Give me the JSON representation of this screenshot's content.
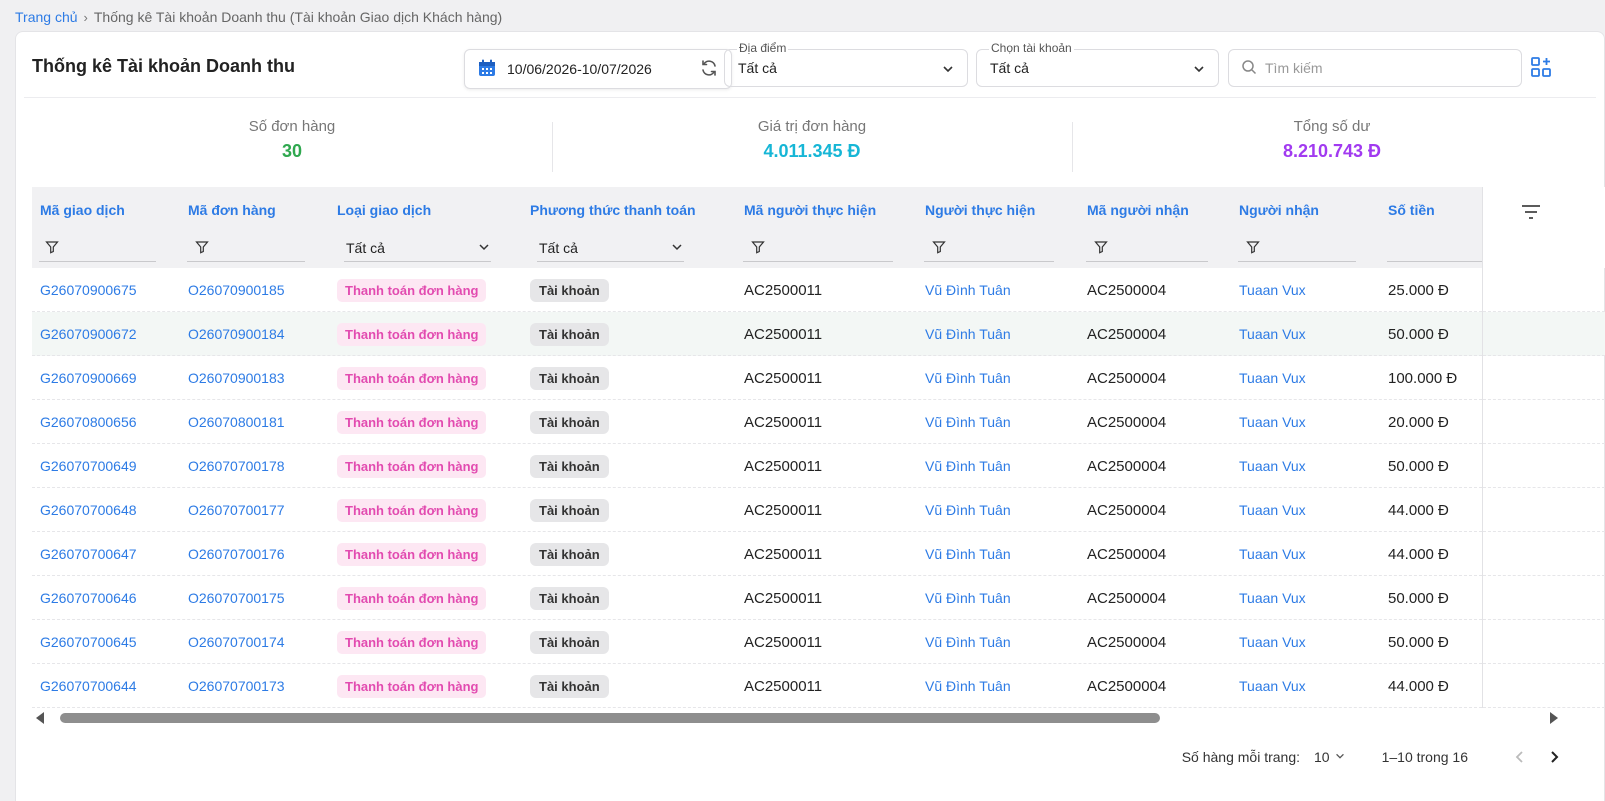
{
  "breadcrumb": {
    "home": "Trang chủ",
    "current": "Thống kê Tài khoản Doanh thu (Tài khoản Giao dịch Khách hàng)"
  },
  "header": {
    "title": "Thống kê Tài khoản Doanh thu",
    "date_range": "10/06/2026-10/07/2026",
    "location": {
      "label": "Địa điểm",
      "value": "Tất cả"
    },
    "account": {
      "label": "Chọn tài khoản",
      "value": "Tất cả"
    },
    "search_placeholder": "Tìm kiếm"
  },
  "stats": [
    {
      "label": "Số đơn hàng",
      "value": "30",
      "color": "#2fa84f"
    },
    {
      "label": "Giá trị đơn hàng",
      "value": "4.011.345 Đ",
      "color": "#16b6d6"
    },
    {
      "label": "Tổng số dư",
      "value": "8.210.743 Đ",
      "color": "#a13af0"
    }
  ],
  "table": {
    "columns": [
      "Mã giao dịch",
      "Mã đơn hàng",
      "Loại giao dịch",
      "Phương thức thanh toán",
      "Mã người thực hiện",
      "Người thực hiện",
      "Mã người nhận",
      "Người nhận",
      "Số tiền"
    ],
    "filters": {
      "type": "Tất cả",
      "method": "Tất cả"
    },
    "rows": [
      {
        "tx": "G26070900675",
        "order": "O26070900185",
        "type": "Thanh toán đơn hàng",
        "method": "Tài khoản",
        "actor_id": "AC2500011",
        "actor": "Vũ Đình Tuân",
        "recv_id": "AC2500004",
        "recv": "Tuaan Vux",
        "amount": "25.000 Đ"
      },
      {
        "tx": "G26070900672",
        "order": "O26070900184",
        "type": "Thanh toán đơn hàng",
        "method": "Tài khoản",
        "actor_id": "AC2500011",
        "actor": "Vũ Đình Tuân",
        "recv_id": "AC2500004",
        "recv": "Tuaan Vux",
        "amount": "50.000 Đ"
      },
      {
        "tx": "G26070900669",
        "order": "O26070900183",
        "type": "Thanh toán đơn hàng",
        "method": "Tài khoản",
        "actor_id": "AC2500011",
        "actor": "Vũ Đình Tuân",
        "recv_id": "AC2500004",
        "recv": "Tuaan Vux",
        "amount": "100.000 Đ"
      },
      {
        "tx": "G26070800656",
        "order": "O26070800181",
        "type": "Thanh toán đơn hàng",
        "method": "Tài khoản",
        "actor_id": "AC2500011",
        "actor": "Vũ Đình Tuân",
        "recv_id": "AC2500004",
        "recv": "Tuaan Vux",
        "amount": "20.000 Đ"
      },
      {
        "tx": "G26070700649",
        "order": "O26070700178",
        "type": "Thanh toán đơn hàng",
        "method": "Tài khoản",
        "actor_id": "AC2500011",
        "actor": "Vũ Đình Tuân",
        "recv_id": "AC2500004",
        "recv": "Tuaan Vux",
        "amount": "50.000 Đ"
      },
      {
        "tx": "G26070700648",
        "order": "O26070700177",
        "type": "Thanh toán đơn hàng",
        "method": "Tài khoản",
        "actor_id": "AC2500011",
        "actor": "Vũ Đình Tuân",
        "recv_id": "AC2500004",
        "recv": "Tuaan Vux",
        "amount": "44.000 Đ"
      },
      {
        "tx": "G26070700647",
        "order": "O26070700176",
        "type": "Thanh toán đơn hàng",
        "method": "Tài khoản",
        "actor_id": "AC2500011",
        "actor": "Vũ Đình Tuân",
        "recv_id": "AC2500004",
        "recv": "Tuaan Vux",
        "amount": "44.000 Đ"
      },
      {
        "tx": "G26070700646",
        "order": "O26070700175",
        "type": "Thanh toán đơn hàng",
        "method": "Tài khoản",
        "actor_id": "AC2500011",
        "actor": "Vũ Đình Tuân",
        "recv_id": "AC2500004",
        "recv": "Tuaan Vux",
        "amount": "50.000 Đ"
      },
      {
        "tx": "G26070700645",
        "order": "O26070700174",
        "type": "Thanh toán đơn hàng",
        "method": "Tài khoản",
        "actor_id": "AC2500011",
        "actor": "Vũ Đình Tuân",
        "recv_id": "AC2500004",
        "recv": "Tuaan Vux",
        "amount": "50.000 Đ"
      },
      {
        "tx": "G26070700644",
        "order": "O26070700173",
        "type": "Thanh toán đơn hàng",
        "method": "Tài khoản",
        "actor_id": "AC2500011",
        "actor": "Vũ Đình Tuân",
        "recv_id": "AC2500004",
        "recv": "Tuaan Vux",
        "amount": "44.000 Đ"
      }
    ]
  },
  "pagination": {
    "rows_per_page_label": "Số hàng mỗi trang:",
    "rows_per_page": "10",
    "range": "1–10 trong 16"
  },
  "icons": [
    "calendar-icon",
    "refresh-icon",
    "chevron-down-icon",
    "search-icon",
    "grid-view-icon",
    "filter-icon",
    "filter-lines-icon",
    "chevron-left-icon",
    "chevron-right-icon"
  ],
  "colors": {
    "link": "#2d7be5",
    "tag_pink_bg": "#fde7f3",
    "tag_pink_text": "#e24bb0"
  }
}
